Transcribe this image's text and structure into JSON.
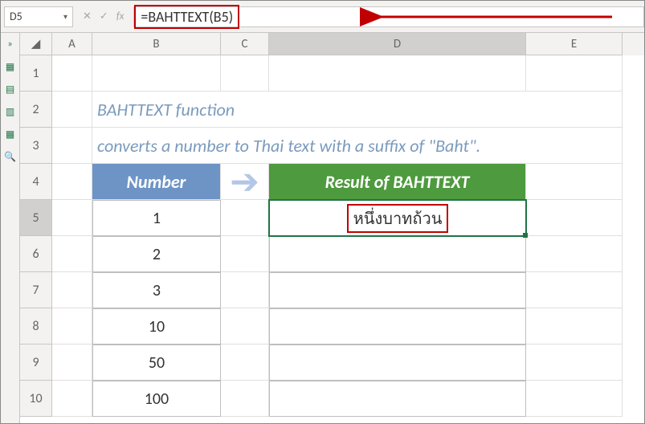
{
  "namebox": {
    "value": "D5"
  },
  "fx": {
    "cancel": "✕",
    "enter": "✓",
    "label": "fx"
  },
  "formula": {
    "text": "=BAHTTEXT(B5)"
  },
  "sideIcons": [
    "»",
    "▦",
    "▤",
    "▥",
    "▦",
    "🔍"
  ],
  "columns": [
    "A",
    "B",
    "C",
    "D",
    "E"
  ],
  "rows": [
    "1",
    "2",
    "3",
    "4",
    "5",
    "6",
    "7",
    "8",
    "9",
    "10"
  ],
  "desc": {
    "line1": "BAHTTEXT function",
    "line2": "converts a number to Thai text with a suffix of \"Baht\"."
  },
  "tableHeaders": {
    "number": "Number",
    "result": "Result of BAHTTEXT"
  },
  "numberValues": [
    "1",
    "2",
    "3",
    "10",
    "50",
    "100"
  ],
  "resultValues": [
    "หนึ่งบาทถ้วน",
    "",
    "",
    "",
    "",
    ""
  ],
  "activeCell": {
    "row": 5,
    "col": "D"
  },
  "chart_data": {
    "type": "table",
    "title": "BAHTTEXT function example",
    "columns": [
      "Number",
      "Result of BAHTTEXT"
    ],
    "rows": [
      [
        1,
        "หนึ่งบาทถ้วน"
      ],
      [
        2,
        ""
      ],
      [
        3,
        ""
      ],
      [
        10,
        ""
      ],
      [
        50,
        ""
      ],
      [
        100,
        ""
      ]
    ]
  }
}
